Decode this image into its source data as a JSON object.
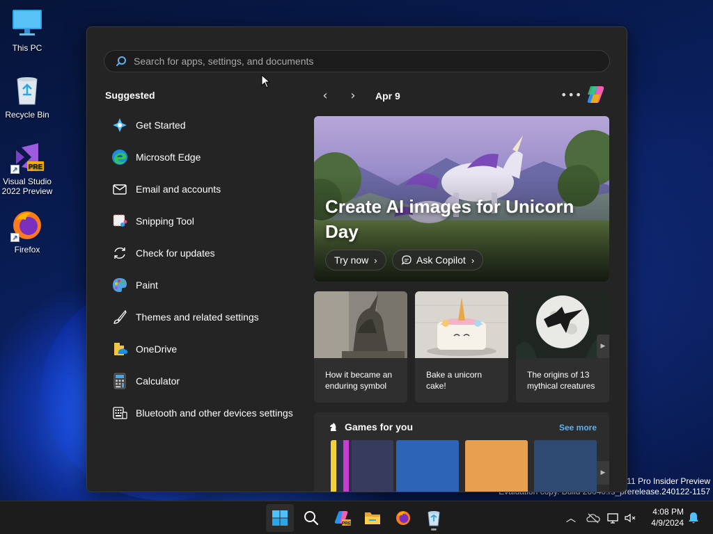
{
  "desktop": {
    "icons": [
      {
        "label": "This PC",
        "icon": "monitor-icon"
      },
      {
        "label": "Recycle Bin",
        "icon": "recycle-bin-icon"
      },
      {
        "label": "Visual Studio 2022 Preview",
        "icon": "visual-studio-icon",
        "badge": "PRE"
      },
      {
        "label": "Firefox",
        "icon": "firefox-icon"
      }
    ]
  },
  "start_menu": {
    "search": {
      "placeholder": "Search for apps, settings, and documents",
      "value": ""
    },
    "suggested": {
      "title": "Suggested",
      "items": [
        {
          "label": "Get Started",
          "icon": "get-started-icon"
        },
        {
          "label": "Microsoft Edge",
          "icon": "edge-icon"
        },
        {
          "label": "Email and accounts",
          "icon": "mail-icon"
        },
        {
          "label": "Snipping Tool",
          "icon": "snipping-tool-icon"
        },
        {
          "label": "Check for updates",
          "icon": "sync-icon"
        },
        {
          "label": "Paint",
          "icon": "paint-palette-icon"
        },
        {
          "label": "Themes and related settings",
          "icon": "brush-icon"
        },
        {
          "label": "OneDrive",
          "icon": "onedrive-icon"
        },
        {
          "label": "Calculator",
          "icon": "calculator-icon"
        },
        {
          "label": "Bluetooth and other devices settings",
          "icon": "keyboard-devices-icon"
        }
      ]
    },
    "feed": {
      "date": "Apr 9",
      "hero": {
        "title": "Create AI images for Unicorn Day",
        "try_label": "Try now",
        "copilot_label": "Ask Copilot"
      },
      "cards": [
        {
          "caption": "How it became an enduring symbol"
        },
        {
          "caption": "Bake a unicorn cake!"
        },
        {
          "caption": "The origins of 13 mythical creatures"
        }
      ],
      "games": {
        "title": "Games for you",
        "see_more": "See more"
      }
    }
  },
  "watermark": {
    "line1": "s 11 Pro Insider Preview",
    "line2": "Evaluation copy. Build 26040.rs_prerelease.240122-1157"
  },
  "taskbar": {
    "apps": [
      "start-button",
      "search-button",
      "copilot-pre-button",
      "file-explorer-button",
      "firefox-button",
      "recycle-app-button"
    ],
    "clock": {
      "time": "4:08 PM",
      "date": "4/9/2024"
    }
  },
  "colors": {
    "accent": "#5fb2f2",
    "start_bg": "#242424",
    "taskbar_bg": "#1c1c1c"
  }
}
